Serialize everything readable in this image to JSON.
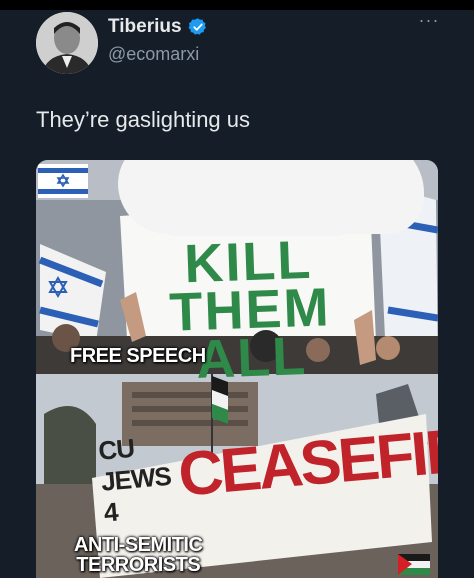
{
  "author": {
    "display_name": "Tiberius",
    "handle": "@ecomarxi",
    "verified": true,
    "avatar_icon": "avatar-photo",
    "more_icon": "more-horizontal-icon"
  },
  "tweet": {
    "text": "They’re gaslighting us"
  },
  "media": {
    "top_caption": "FREE SPEECH",
    "sign_text_line1": "KILL",
    "sign_text_line2": "THEM",
    "sign_text_line3": "ALL",
    "bottom_caption_line1": "ANTI-SEMITIC",
    "bottom_caption_line2": "TERRORISTS",
    "banner_small": "CU JEWS 4",
    "banner_big": "CEASEFIRE",
    "flag_top": "israel-flag-icon",
    "flag_bottom": "palestine-flag-icon"
  },
  "colors": {
    "background": "#151d28",
    "verified_blue": "#1d9bf0",
    "sign_green": "#2f8a4a",
    "banner_red": "#c0232a"
  }
}
